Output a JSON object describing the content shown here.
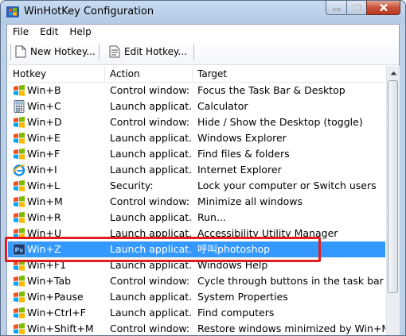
{
  "window": {
    "title": "WinHotKey Configuration"
  },
  "menubar": {
    "items": [
      "File",
      "Edit",
      "Help"
    ]
  },
  "toolbar": {
    "new_label": "New Hotkey...",
    "edit_label": "Edit Hotkey..."
  },
  "columns": [
    "Hotkey",
    "Action",
    "Target"
  ],
  "rows": [
    {
      "icon": "windows-flag-icon",
      "hotkey": "Win+B",
      "action": "Control window:",
      "target": "Focus the Task Bar & Desktop"
    },
    {
      "icon": "calculator-icon",
      "hotkey": "Win+C",
      "action": "Launch applicat...",
      "target": "Calculator"
    },
    {
      "icon": "windows-flag-icon",
      "hotkey": "Win+D",
      "action": "Control window:",
      "target": "Hide / Show the Desktop (toggle)"
    },
    {
      "icon": "windows-flag-icon",
      "hotkey": "Win+E",
      "action": "Launch applicat...",
      "target": "Windows Explorer"
    },
    {
      "icon": "windows-flag-icon",
      "hotkey": "Win+F",
      "action": "Launch applicat...",
      "target": "Find files & folders"
    },
    {
      "icon": "internet-explorer-icon",
      "hotkey": "Win+I",
      "action": "Launch applicat...",
      "target": "Internet Explorer"
    },
    {
      "icon": "windows-flag-icon",
      "hotkey": "Win+L",
      "action": "Security:",
      "target": "Lock your computer or Switch users"
    },
    {
      "icon": "windows-flag-icon",
      "hotkey": "Win+M",
      "action": "Control window:",
      "target": "Minimize all windows"
    },
    {
      "icon": "windows-flag-icon",
      "hotkey": "Win+R",
      "action": "Launch applicat...",
      "target": "Run..."
    },
    {
      "icon": "windows-flag-icon",
      "hotkey": "Win+U",
      "action": "Launch applicat...",
      "target": "Accessibility Utility Manager"
    },
    {
      "icon": "photoshop-icon",
      "hotkey": "Win+Z",
      "action": "Launch applicat...",
      "target": "呼叫photoshop",
      "selected": true
    },
    {
      "icon": "windows-flag-icon",
      "hotkey": "Win+F1",
      "action": "Launch applicat...",
      "target": "Windows Help"
    },
    {
      "icon": "windows-flag-icon",
      "hotkey": "Win+Tab",
      "action": "Control window:",
      "target": "Cycle through buttons in the task bar"
    },
    {
      "icon": "windows-flag-icon",
      "hotkey": "Win+Pause",
      "action": "Launch applicat...",
      "target": "System Properties"
    },
    {
      "icon": "windows-flag-icon",
      "hotkey": "Win+Ctrl+F",
      "action": "Launch applicat...",
      "target": "Find computers"
    },
    {
      "icon": "windows-flag-icon",
      "hotkey": "Win+Shift+M",
      "action": "Control window:",
      "target": "Restore windows minimized by Win+M"
    }
  ],
  "colors": {
    "selection": "#3399ff",
    "highlight_box": "#e31d1d",
    "titlebar": "#b4cbe6"
  }
}
